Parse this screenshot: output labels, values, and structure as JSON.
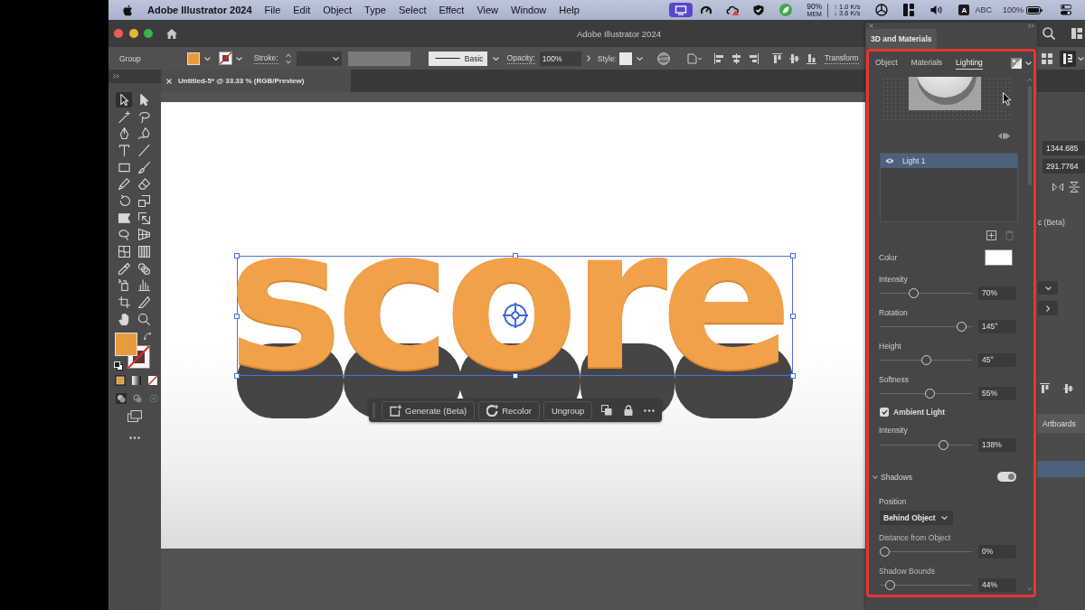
{
  "menu_bar": {
    "app_name": "Adobe Illustrator 2024",
    "menus": [
      "File",
      "Edit",
      "Object",
      "Type",
      "Select",
      "Effect",
      "View",
      "Window",
      "Help"
    ],
    "memory": "90%",
    "memory_label": "MEM",
    "upload_rate": "↑ 1.0 K/s",
    "download_rate": "↓ 3.6 K/s",
    "input_badge": "A",
    "input_source": "ABC",
    "battery": "100%"
  },
  "window": {
    "title": "Adobe Illustrator 2024"
  },
  "control_bar": {
    "selection": "Group",
    "stroke_label": "Stroke:",
    "brush": "Basic",
    "opacity_label": "Opacity:",
    "opacity": "100%",
    "style_label": "Style:",
    "transform_link": "Transform"
  },
  "document_tab": {
    "title": "Untitled-5* @ 33.33 % (RGB/Preview)"
  },
  "toolbar": {
    "tools": [
      {
        "selected": true
      },
      {
        "selected": false
      },
      {
        "selected": false
      },
      {
        "selected": false
      },
      {
        "selected": false
      },
      {
        "selected": false
      },
      {
        "selected": false
      },
      {
        "selected": false
      },
      {
        "selected": false
      },
      {
        "selected": false
      },
      {
        "selected": false
      },
      {
        "selected": false
      },
      {
        "selected": false
      },
      {
        "selected": false
      },
      {
        "selected": false
      },
      {
        "selected": false
      },
      {
        "selected": false
      },
      {
        "selected": false
      },
      {
        "selected": false
      },
      {
        "selected": false
      },
      {
        "selected": false
      },
      {
        "selected": false
      },
      {
        "selected": false
      },
      {
        "selected": false
      },
      {
        "selected": false
      },
      {
        "selected": false
      },
      {
        "selected": false
      },
      {
        "selected": false
      }
    ]
  },
  "artwork": {
    "text": "score"
  },
  "task_bar": {
    "buttons": [
      {
        "kind": "generate",
        "label": "Generate (Beta)"
      },
      {
        "kind": "recolor",
        "label": "Recolor"
      },
      {
        "kind": "plain",
        "label": "Ungroup"
      }
    ]
  },
  "properties_dock": {
    "fields": [
      "1344.685",
      "291.7764"
    ],
    "partial_label": "c (Beta)",
    "panel_tab": "Artboards"
  },
  "materials_panel": {
    "title": "3D and Materials",
    "tabs": [
      {
        "label": "Object",
        "selected": false
      },
      {
        "label": "Materials",
        "selected": false
      },
      {
        "label": "Lighting",
        "selected": true
      }
    ],
    "lights": [
      {
        "label": "Light 1",
        "selected": true,
        "visible": true
      }
    ],
    "color_label": "Color",
    "light_sliders": [
      {
        "label": "Intensity",
        "level": 0.35,
        "reading": "70%"
      },
      {
        "label": "Rotation",
        "level": 0.93,
        "reading": "145°"
      },
      {
        "label": "Height",
        "level": 0.51,
        "reading": "45°"
      },
      {
        "label": "Softness",
        "level": 0.55,
        "reading": "55%"
      }
    ],
    "ambient_light": {
      "label": "Ambient Light",
      "checked": true,
      "slider": {
        "label": "Intensity",
        "level": 0.71,
        "reading": "138%"
      }
    },
    "shadows": {
      "label": "Shadows",
      "expanded": true,
      "on": true,
      "position_label": "Position",
      "position": "Behind Object",
      "sliders": [
        {
          "label": "Distance from Object",
          "level": 0,
          "reading": "0%"
        },
        {
          "label": "Shadow Bounds",
          "level": 0.07,
          "reading": "44%"
        }
      ]
    }
  }
}
